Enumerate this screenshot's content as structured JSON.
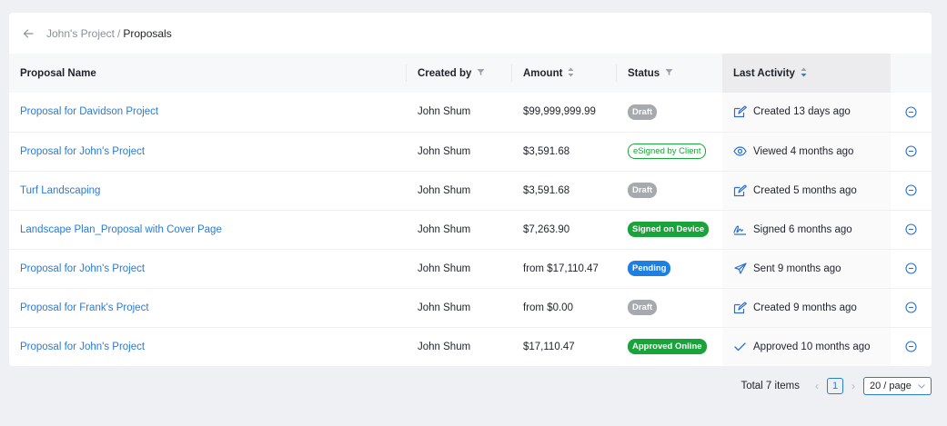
{
  "breadcrumb": {
    "parent": "John's Project",
    "separator": "/",
    "current": "Proposals"
  },
  "columns": {
    "name": "Proposal Name",
    "created_by": "Created by",
    "amount": "Amount",
    "status": "Status",
    "last_activity": "Last Activity"
  },
  "rows": [
    {
      "name": "Proposal for Davidson Project",
      "created_by": "John Shum",
      "amount": "$99,999,999.99",
      "status": "Draft",
      "status_color": "#a6a9ae",
      "activity_icon": "edit-icon",
      "activity": "Created 13 days ago"
    },
    {
      "name": "Proposal for John's Project",
      "created_by": "John Shum",
      "amount": "$3,591.68",
      "status": "eSigned by Client",
      "status_color": "#19a33a",
      "activity_icon": "eye-icon",
      "activity": "Viewed 4 months ago"
    },
    {
      "name": "Turf Landscaping",
      "created_by": "John Shum",
      "amount": "$3,591.68",
      "status": "Draft",
      "status_color": "#a6a9ae",
      "activity_icon": "edit-icon",
      "activity": "Created 5 months ago"
    },
    {
      "name": "Landscape Plan_Proposal with Cover Page",
      "created_by": "John Shum",
      "amount": "$7,263.90",
      "status": "Signed on Device",
      "status_color": "#19a33a",
      "activity_icon": "signature-icon",
      "activity": "Signed 6 months ago"
    },
    {
      "name": "Proposal for John's Project",
      "created_by": "John Shum",
      "amount": "from $17,110.47",
      "status": "Pending",
      "status_color": "#1f7fe0",
      "activity_icon": "send-icon",
      "activity": "Sent 9 months ago"
    },
    {
      "name": "Proposal for Frank's Project",
      "created_by": "John Shum",
      "amount": "from $0.00",
      "status": "Draft",
      "status_color": "#a6a9ae",
      "activity_icon": "edit-icon",
      "activity": "Created 9 months ago"
    },
    {
      "name": "Proposal for John's Project",
      "created_by": "John Shum",
      "amount": "$17,110.47",
      "status": "Approved Online",
      "status_color": "#19a33a",
      "activity_icon": "check-icon",
      "activity": "Approved 10 months ago"
    }
  ],
  "pagination": {
    "total": "Total 7 items",
    "current_page": "1",
    "page_size": "20 / page"
  },
  "colors": {
    "accent": "#2a7bd3",
    "green": "#19a33a",
    "grey": "#a6a9ae",
    "blue": "#1f7fe0"
  }
}
